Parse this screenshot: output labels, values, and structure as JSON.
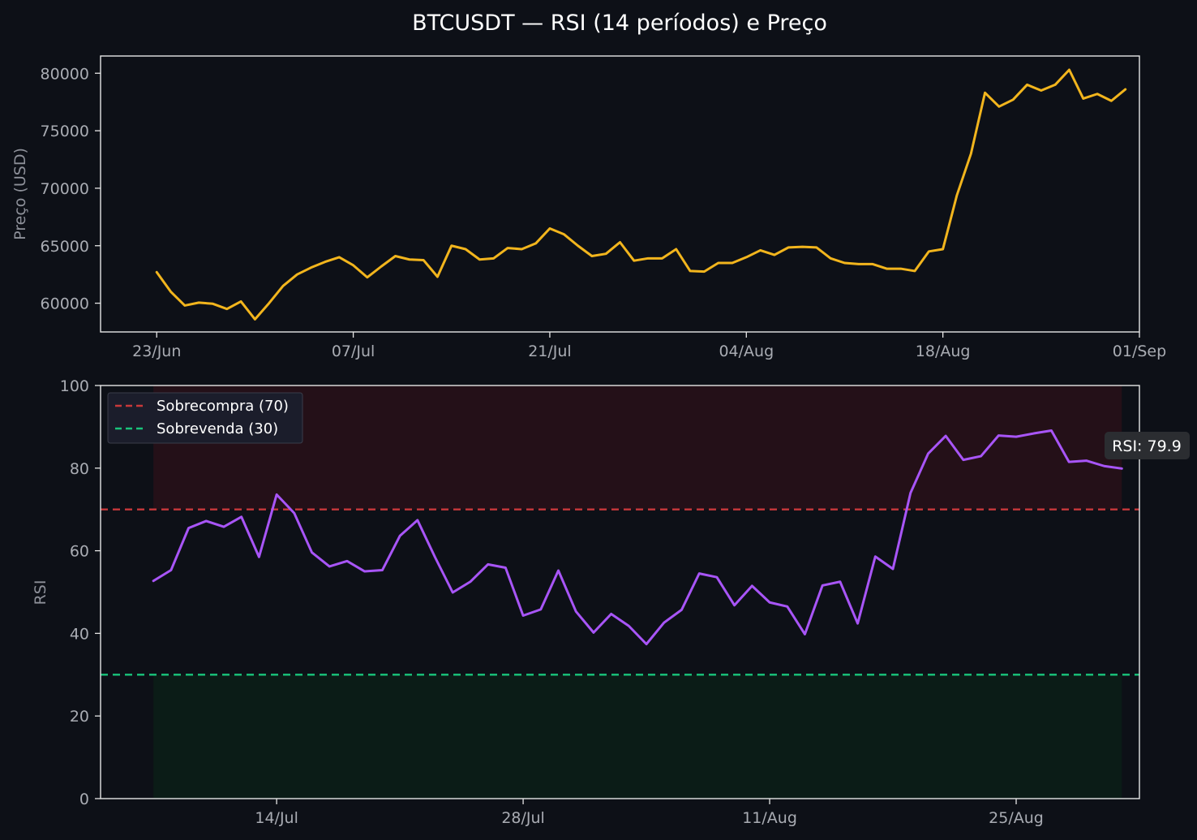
{
  "title": "BTCUSDT — RSI (14 períodos) e Preço",
  "colors": {
    "background": "#0d1017",
    "price_line": "#f2b51d",
    "rsi_line": "#a855f7",
    "overbought_line": "#c8383b",
    "oversold_line": "#19c47b",
    "overbought_zone": "#241018",
    "oversold_zone": "#0b1c17",
    "axis": "#e6e6e6",
    "tick_text": "#a9acb3"
  },
  "chart_data": [
    {
      "type": "line",
      "panel": "price",
      "ylabel": "Preço (USD)",
      "xlabel": "",
      "ylim": [
        57500,
        81500
      ],
      "yticks": [
        60000,
        65000,
        70000,
        75000,
        80000
      ],
      "xlim": [
        "2025-06-19",
        "2025-09-01"
      ],
      "xticks": [
        {
          "date": "2025-06-23",
          "label": "23/Jun"
        },
        {
          "date": "2025-07-07",
          "label": "07/Jul"
        },
        {
          "date": "2025-07-21",
          "label": "21/Jul"
        },
        {
          "date": "2025-08-04",
          "label": "04/Aug"
        },
        {
          "date": "2025-08-18",
          "label": "18/Aug"
        },
        {
          "date": "2025-09-01",
          "label": "01/Sep"
        }
      ],
      "grid": false,
      "series": [
        {
          "start_date": "2025-06-23",
          "values": [
            62700,
            61000,
            59800,
            60050,
            59950,
            59500,
            60150,
            58600,
            60000,
            61500,
            62500,
            63100,
            63600,
            64000,
            63300,
            62250,
            63200,
            64100,
            63800,
            63750,
            62300,
            65000,
            64700,
            63800,
            63900,
            64800,
            64700,
            65200,
            66500,
            66000,
            65000,
            64100,
            64300,
            65300,
            63700,
            63900,
            63900,
            64700,
            62800,
            62750,
            63500,
            63500,
            64000,
            64600,
            64200,
            64850,
            64900,
            64850,
            63900,
            63500,
            63400,
            63400,
            63000,
            63000,
            62800,
            64500,
            64700,
            69400,
            73000,
            78300,
            77100,
            77700,
            79000,
            78500,
            79000,
            80300,
            77800,
            78200,
            77600,
            78600
          ]
        }
      ]
    },
    {
      "type": "line",
      "panel": "rsi",
      "ylabel": "RSI",
      "xlabel": "",
      "ylim": [
        0,
        100
      ],
      "yticks": [
        0,
        20,
        40,
        60,
        80,
        100
      ],
      "xlim": [
        "2025-07-04",
        "2025-09-01"
      ],
      "xticks": [
        {
          "date": "2025-07-14",
          "label": "14/Jul"
        },
        {
          "date": "2025-07-28",
          "label": "28/Jul"
        },
        {
          "date": "2025-08-11",
          "label": "11/Aug"
        },
        {
          "date": "2025-08-25",
          "label": "25/Aug"
        }
      ],
      "grid": false,
      "legend_position": "top-left",
      "legend": [
        "Sobrecompra (70)",
        "Sobrevenda (30)"
      ],
      "reference_lines": [
        {
          "label": "Sobrecompra (70)",
          "value": 70
        },
        {
          "label": "Sobrevenda (30)",
          "value": 30
        }
      ],
      "shaded_zones": [
        {
          "from": 70,
          "to": 100
        },
        {
          "from": 0,
          "to": 30
        }
      ],
      "annotation": "RSI: 79.9",
      "series": [
        {
          "start_date": "2025-07-07",
          "values": [
            52.7,
            55.3,
            65.5,
            67.2,
            65.8,
            68.2,
            58.5,
            73.6,
            69.1,
            59.6,
            56.2,
            57.5,
            55.0,
            55.3,
            63.6,
            67.4,
            58.4,
            49.9,
            52.5,
            56.7,
            55.9,
            44.3,
            45.8,
            55.2,
            45.3,
            40.2,
            44.7,
            41.8,
            37.4,
            42.6,
            45.7,
            54.5,
            53.6,
            46.8,
            51.5,
            47.5,
            46.5,
            39.8,
            51.6,
            52.5,
            42.4,
            58.6,
            55.6,
            74.0,
            83.5,
            87.8,
            82.0,
            82.9,
            87.9,
            87.6,
            88.4,
            89.1,
            81.5,
            81.8,
            80.5,
            79.9
          ]
        }
      ]
    }
  ]
}
